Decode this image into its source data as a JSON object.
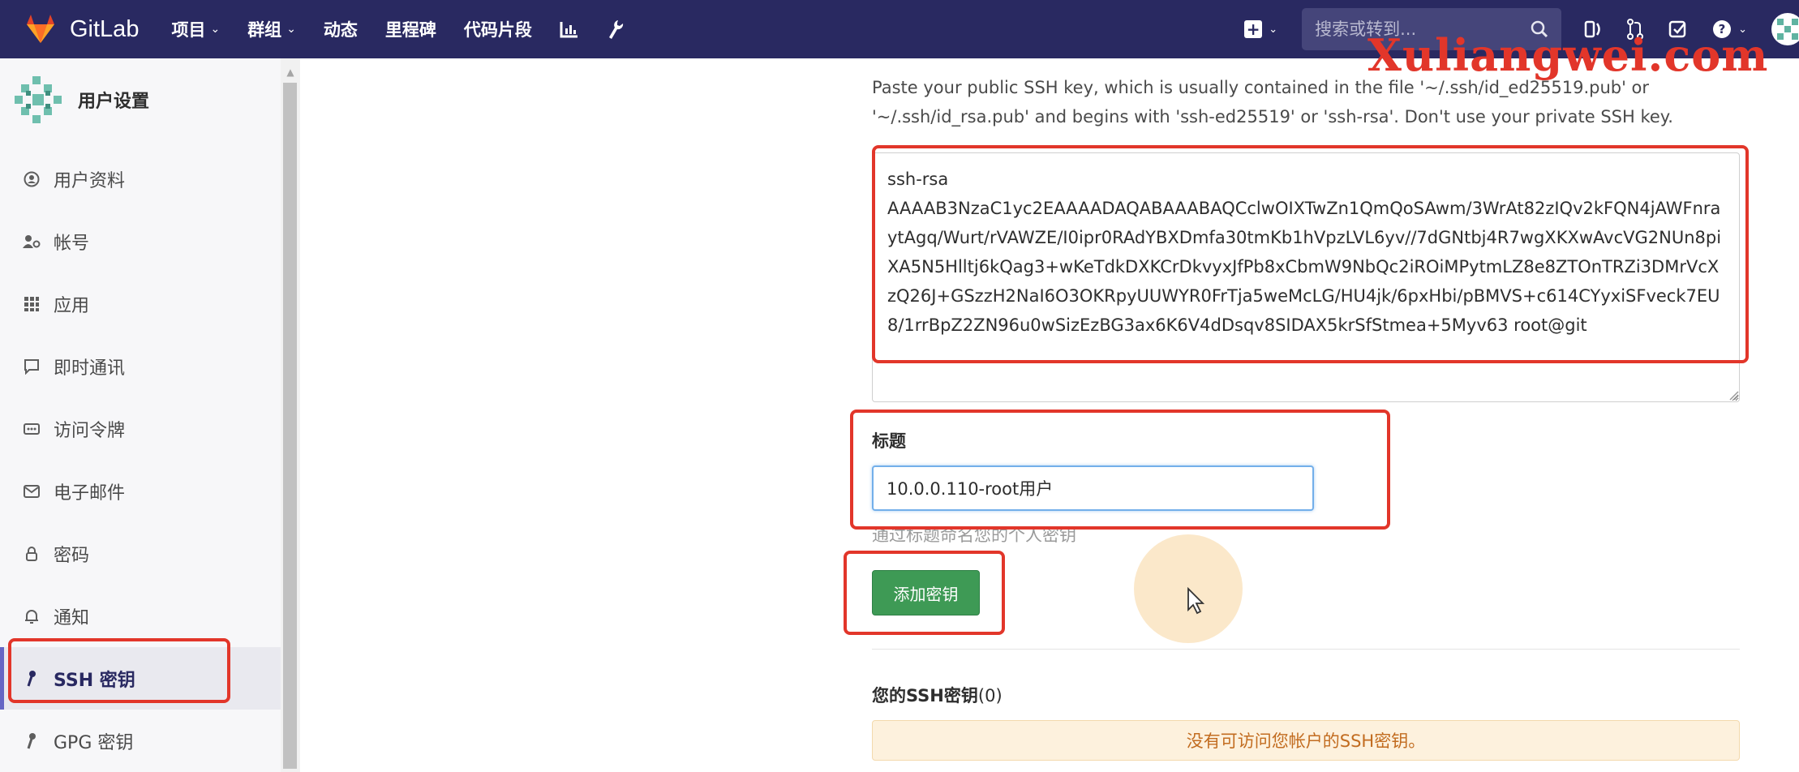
{
  "navbar": {
    "brand": "GitLab",
    "links": [
      {
        "label": "项目",
        "has_dropdown": true
      },
      {
        "label": "群组",
        "has_dropdown": true
      },
      {
        "label": "动态",
        "has_dropdown": false
      },
      {
        "label": "里程碑",
        "has_dropdown": false
      },
      {
        "label": "代码片段",
        "has_dropdown": false
      }
    ],
    "search_placeholder": "搜索或转到...",
    "icons": [
      "chart-icon",
      "wrench-icon",
      "plus-icon",
      "search-icon",
      "sidebar-icon",
      "merge-request-icon",
      "todo-icon",
      "help-icon",
      "avatar"
    ]
  },
  "watermark": "Xuliangwei.com",
  "sidebar": {
    "title": "用户设置",
    "items": [
      {
        "label": "用户资料",
        "icon": "profile-icon"
      },
      {
        "label": "帐号",
        "icon": "account-icon"
      },
      {
        "label": "应用",
        "icon": "applications-icon"
      },
      {
        "label": "即时通讯",
        "icon": "chat-icon"
      },
      {
        "label": "访问令牌",
        "icon": "token-icon"
      },
      {
        "label": "电子邮件",
        "icon": "mail-icon"
      },
      {
        "label": "密码",
        "icon": "lock-icon"
      },
      {
        "label": "通知",
        "icon": "bell-icon"
      },
      {
        "label": "SSH 密钥",
        "icon": "key-icon",
        "active": true
      },
      {
        "label": "GPG 密钥",
        "icon": "key-icon"
      }
    ]
  },
  "main": {
    "help_text": "Paste your public SSH key, which is usually contained in the file '~/.ssh/id_ed25519.pub' or '~/.ssh/id_rsa.pub' and begins with 'ssh-ed25519' or 'ssh-rsa'. Don't use your private SSH key.",
    "key_value": "ssh-rsa\nAAAAB3NzaC1yc2EAAAADAQABAAABAQCclwOIXTwZn1QmQoSAwm/3WrAt82zIQv2kFQN4jAWFnraytAgq/Wurt/rVAWZE/I0ipr0RAdYBXDmfa30tmKb1hVpzLVL6yv//7dGNtbj4R7wgXKXwAvcVG2NUn8piXA5N5Hlltj6kQag3+wKeTdkDXKCrDkvyxJfPb8xCbmW9NbQc2iROiMPytmLZ8e8ZTOnTRZi3DMrVcXzQ26J+GSzzH2NaI6O3OKRpyUUWYR0FrTja5weMcLG/HU4jk/6pxHbi/pBMVS+c614CYyxiSFveck7EU8/1rrBpZ2ZN96u0wSizEzBG3ax6K6V4dDsqv8SIDAX5krSfStmea+5Myv63 root@git",
    "title_label": "标题",
    "title_value": "10.0.0.110-root用户",
    "title_help": "通过标题命名您的个人密钥",
    "add_button": "添加密钥",
    "keys_heading": "您的SSH密钥",
    "keys_count": "(0)",
    "empty_alert": "没有可访问您帐户的SSH密钥。"
  },
  "colors": {
    "navbar": "#292961",
    "accent": "#6666c4",
    "button_green": "#3e9a55",
    "highlight_red": "#e2362a",
    "alert_bg": "#fdf1dd",
    "alert_text": "#c26c20"
  }
}
